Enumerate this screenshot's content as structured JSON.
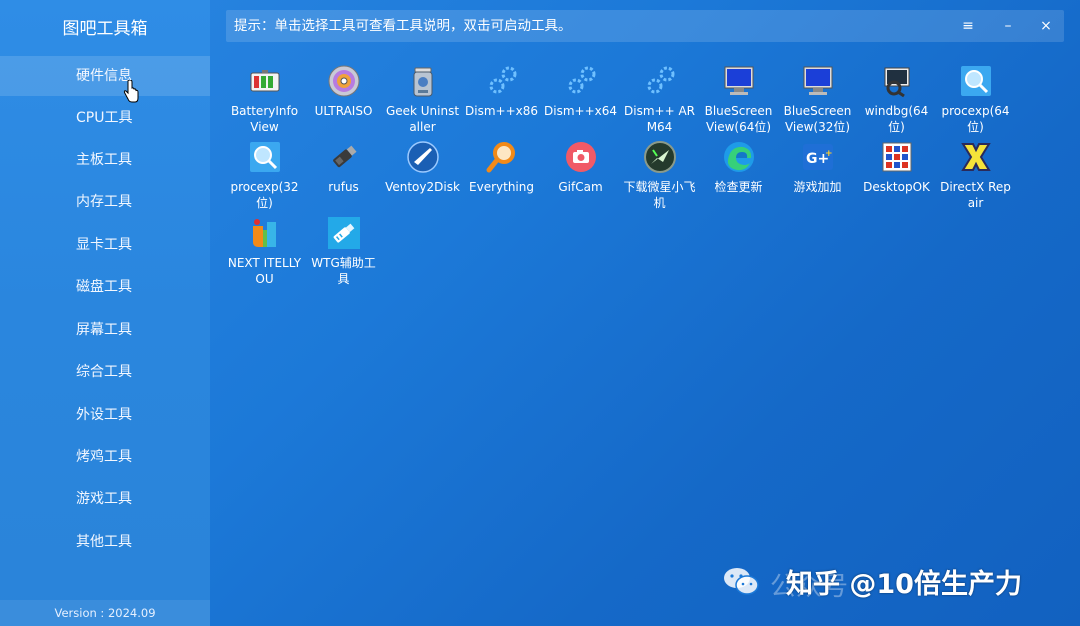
{
  "app": {
    "title": "图吧工具箱",
    "version": "Version : 2024.09"
  },
  "tipbar": {
    "text": "提示：单击选择工具可查看工具说明，双击可启动工具。",
    "menu_glyph": "≡",
    "minimize_glyph": "–",
    "close_glyph": "×"
  },
  "sidebar": {
    "items": [
      {
        "label": "硬件信息",
        "active": true
      },
      {
        "label": "CPU工具"
      },
      {
        "label": "主板工具"
      },
      {
        "label": "内存工具"
      },
      {
        "label": "显卡工具"
      },
      {
        "label": "磁盘工具"
      },
      {
        "label": "屏幕工具"
      },
      {
        "label": "综合工具"
      },
      {
        "label": "外设工具"
      },
      {
        "label": "烤鸡工具"
      },
      {
        "label": "游戏工具"
      },
      {
        "label": "其他工具"
      }
    ]
  },
  "tools": [
    {
      "label": "BatteryInfoView",
      "icon": "battery-icon"
    },
    {
      "label": "ULTRAISO",
      "icon": "disc-icon"
    },
    {
      "label": "Geek Uninstaller",
      "icon": "trash-can-icon"
    },
    {
      "label": "Dism++x86",
      "icon": "gears-icon"
    },
    {
      "label": "Dism++x64",
      "icon": "gears-icon"
    },
    {
      "label": "Dism++ ARM64",
      "icon": "gears-icon"
    },
    {
      "label": "BlueScreenView(64位)",
      "icon": "monitor-icon"
    },
    {
      "label": "BlueScreenView(32位)",
      "icon": "monitor-icon"
    },
    {
      "label": "windbg(64位)",
      "icon": "debugger-icon"
    },
    {
      "label": "procexp(64位)",
      "icon": "magnifier-icon"
    },
    {
      "label": "procexp(32位)",
      "icon": "magnifier-icon"
    },
    {
      "label": "rufus",
      "icon": "usb-drive-icon"
    },
    {
      "label": "Ventoy2Disk",
      "icon": "ventoy-icon"
    },
    {
      "label": "Everything",
      "icon": "search-icon"
    },
    {
      "label": "GifCam",
      "icon": "camera-icon"
    },
    {
      "label": "下载微星小飞机",
      "icon": "afterburner-icon"
    },
    {
      "label": "检查更新",
      "icon": "edge-icon"
    },
    {
      "label": "游戏加加",
      "icon": "game-plus-icon"
    },
    {
      "label": "DesktopOK",
      "icon": "desktop-grid-icon"
    },
    {
      "label": "DirectX Repair",
      "icon": "directx-icon"
    },
    {
      "label": "NEXT ITELLYOU",
      "icon": "itellyou-icon"
    },
    {
      "label": "WTG辅助工具",
      "icon": "wtg-icon"
    }
  ],
  "watermark": {
    "text": "知乎 @10倍生产力",
    "ghost_text": "公众号"
  },
  "colors": {
    "accent": "#1c79d8",
    "sidebar": "#2a86de"
  }
}
